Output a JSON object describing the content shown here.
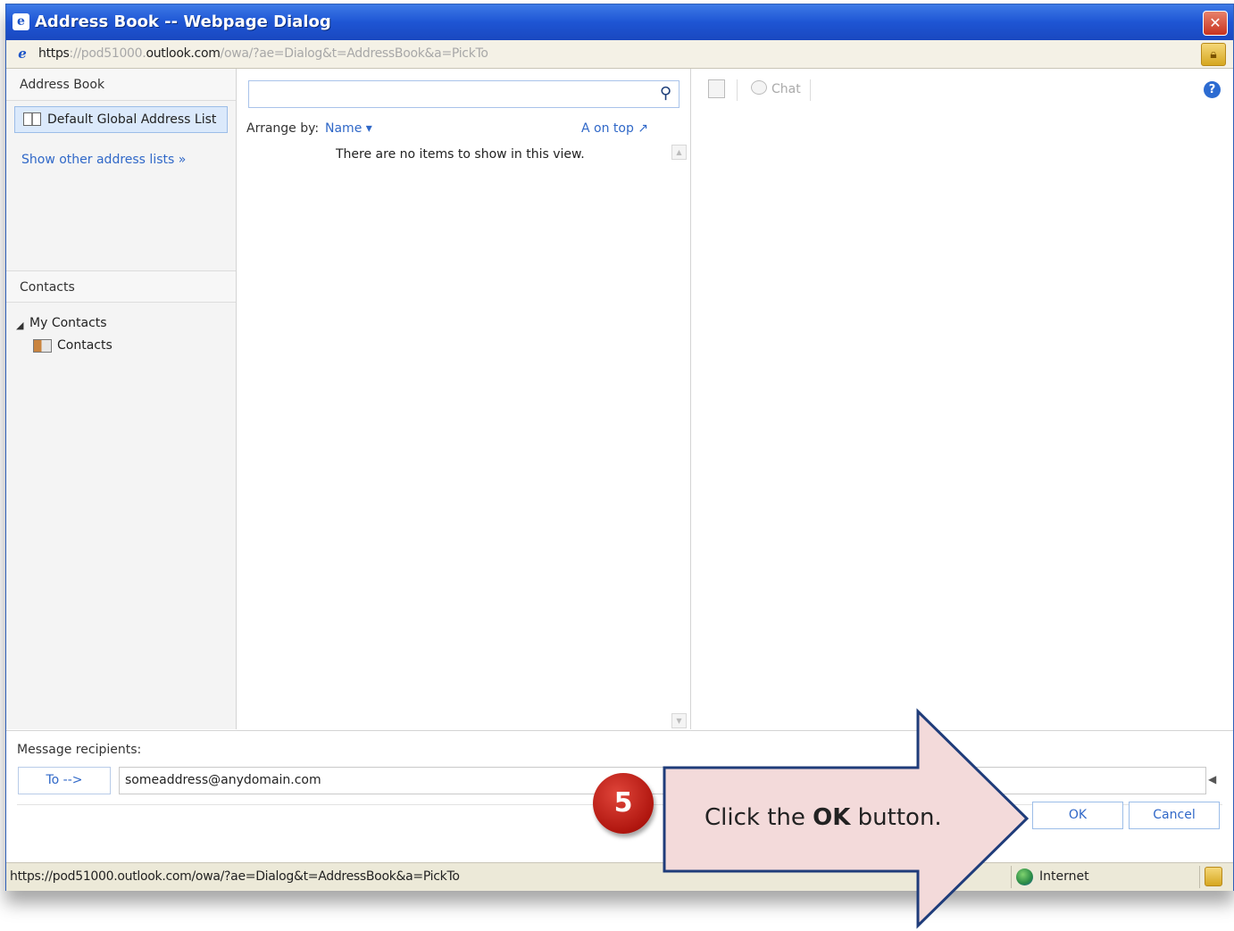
{
  "window": {
    "title": "Address Book -- Webpage Dialog",
    "close_glyph": "✕",
    "url_prefix": "https",
    "url_sep": "://pod51000.",
    "url_domain": "outlook.com",
    "url_path": "/owa/?ae=Dialog&t=AddressBook&a=PickTo"
  },
  "left_pane": {
    "header": "Address Book",
    "selected_list": "Default Global Address List",
    "show_other": "Show other address lists »",
    "contacts_header": "Contacts",
    "tree_toggle": "◢",
    "tree": {
      "group": "My Contacts",
      "item": "Contacts"
    }
  },
  "middle_pane": {
    "search_placeholder": "",
    "search_glyph": "⚲",
    "arrange_label": "Arrange by:",
    "arrange_value": "Name ▾",
    "sort_order": "A on top ↗",
    "empty_message": "There are no items to show in this view.",
    "scroll_up_glyph": "▲",
    "scroll_down_glyph": "▼"
  },
  "right_pane": {
    "chat_label": "Chat",
    "help_glyph": "?"
  },
  "recipients": {
    "label": "Message recipients:",
    "to_button": "To -->",
    "to_value": "someaddress@anydomain.com",
    "scroll_glyph": "◀"
  },
  "buttons": {
    "ok": "OK",
    "cancel": "Cancel"
  },
  "status_bar": {
    "url": "https://pod51000.outlook.com/owa/?ae=Dialog&t=AddressBook&a=PickTo",
    "zone": "Internet"
  },
  "callout": {
    "step_number": "5",
    "text_before": "Click the ",
    "text_bold": "OK",
    "text_after": " button.",
    "fill_color": "#f3dada",
    "stroke_color": "#1f3c7a"
  },
  "icons": {
    "title": "ie-icon",
    "close": "close-icon",
    "lock": "lock-icon",
    "search": "search-icon",
    "help": "help-icon",
    "globe": "globe-icon"
  }
}
